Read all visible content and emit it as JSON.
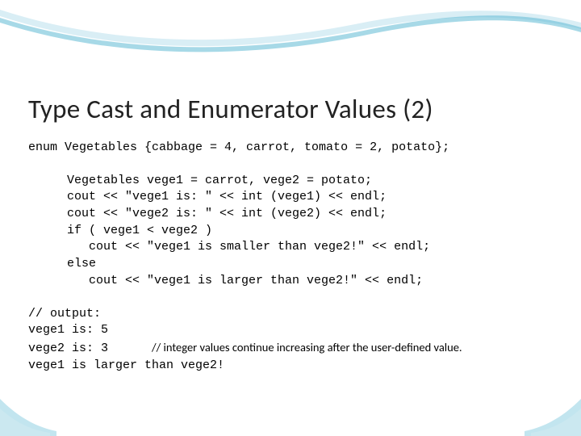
{
  "title": "Type Cast and Enumerator Values (2)",
  "enum_line": "enum Vegetables {cabbage = 4, carrot, tomato = 2, potato};",
  "code": {
    "l1": "Vegetables vege1 = carrot, vege2 = potato;",
    "l2": "cout << \"vege1 is: \" << int (vege1) << endl;",
    "l3": "cout << \"vege2 is: \" << int (vege2) << endl;",
    "l4": "if ( vege1 < vege2 )",
    "l5": "   cout << \"vege1 is smaller than vege2!\" << endl;",
    "l6": "else",
    "l7": "   cout << \"vege1 is larger than vege2!\" << endl;"
  },
  "output": {
    "l1": "// output:",
    "l2": "vege1 is: 5",
    "l3_prefix": "vege2 is: 3      ",
    "l3_comment": "// integer values continue increasing after the user-defined value.",
    "l4": "vege1 is larger than vege2!"
  }
}
